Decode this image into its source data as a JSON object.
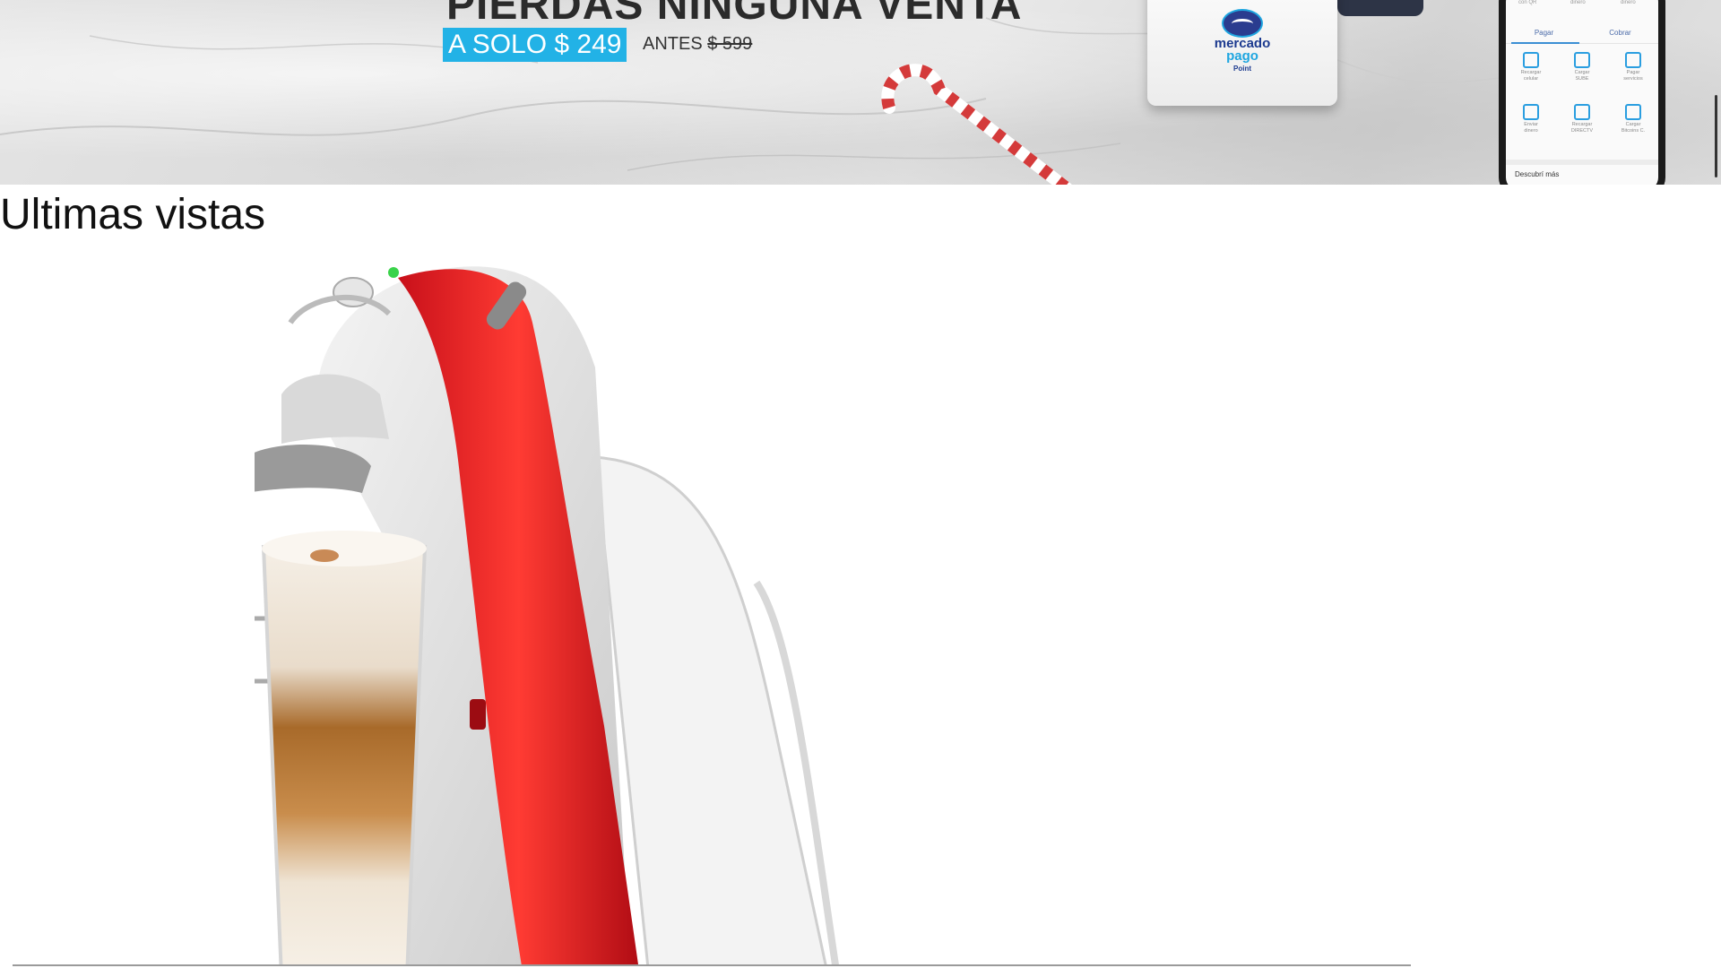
{
  "banner": {
    "headline": "PIERDAS NINGUNA VENTA",
    "price_now": "A SOLO $ 249",
    "price_before_label": "ANTES",
    "price_before_value": "$ 599",
    "device_brand_line1": "mercado",
    "device_brand_line2": "pago",
    "device_brand_line3": "Point",
    "phone": {
      "top_labels": [
        "con QR",
        "dinero",
        "dinero"
      ],
      "tabs": [
        "Pagar",
        "Cobrar"
      ],
      "grid": [
        [
          "Recargar",
          "celular"
        ],
        [
          "Cargar",
          "SUBE"
        ],
        [
          "Pagar",
          "servicios"
        ],
        [
          "Enviar",
          "dinero"
        ],
        [
          "Recargar",
          "DIRECTV"
        ],
        [
          "Cargar",
          "Bitcoins C."
        ]
      ],
      "discover": "Descubrí más"
    },
    "colors": {
      "price_bg": "#22b2e6",
      "brand": "#1c3a8f"
    }
  },
  "section": {
    "title": "Ultimas vistas"
  },
  "product": {
    "image_icon": "coffee-machine-image"
  }
}
